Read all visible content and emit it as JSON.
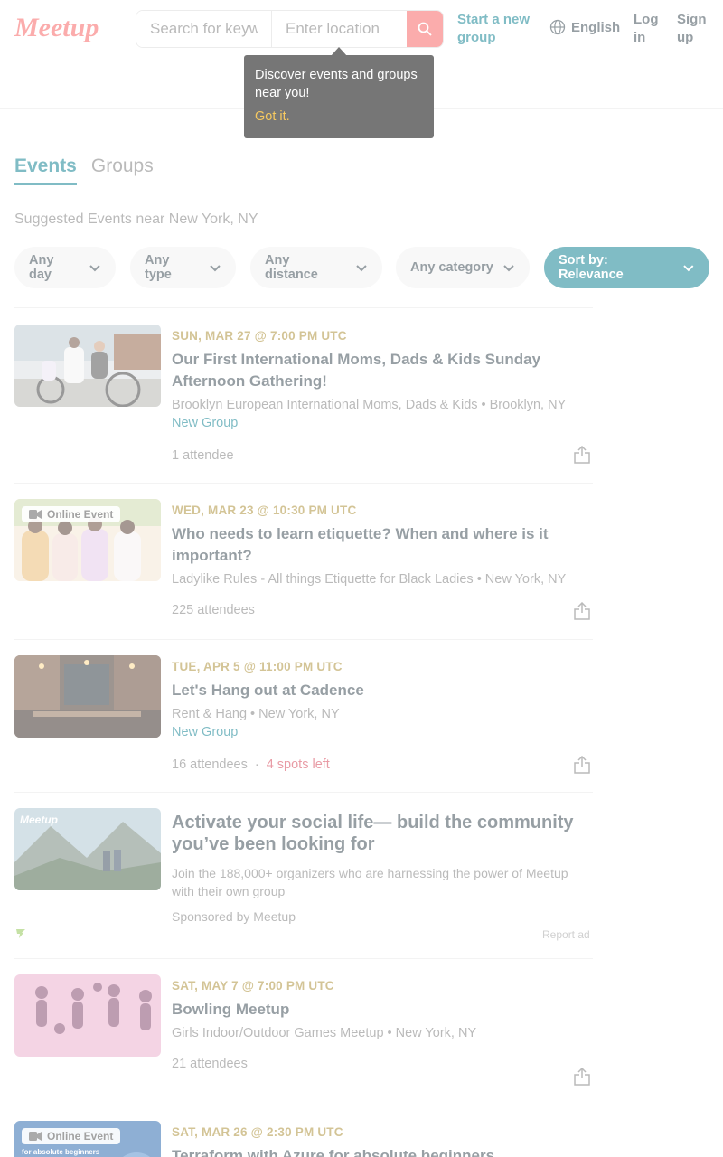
{
  "header": {
    "logo_text": "Meetup",
    "search_placeholder": "Search for keyword",
    "location_placeholder": "Enter location",
    "start_group": "Start a new group",
    "language": "English",
    "login": "Log in",
    "signup": "Sign up"
  },
  "popover": {
    "text": "Discover events and groups near you!",
    "button": "Got it."
  },
  "tabs": [
    {
      "label": "Events",
      "active": true
    },
    {
      "label": "Groups",
      "active": false
    }
  ],
  "subtitle": "Suggested Events near New York, NY",
  "filters": [
    "Any day",
    "Any type",
    "Any distance",
    "Any category"
  ],
  "sort": "Sort by: Relevance",
  "events": [
    {
      "date": "SUN, MAR 27 @ 7:00 PM UTC",
      "title": "Our First International Moms, Dads & Kids Sunday Afternoon Gathering!",
      "group": "Brooklyn European International Moms, Dads & Kids • Brooklyn, NY",
      "new_group": "New Group",
      "attendees": "1 attendee"
    },
    {
      "badge": "Online Event",
      "date": "WED, MAR 23 @ 10:30 PM UTC",
      "title": "Who needs to learn etiquette? When and where is it important?",
      "group": "Ladylike Rules - All things Etiquette for Black Ladies • New York, NY",
      "attendees": "225 attendees"
    },
    {
      "date": "TUE, APR 5 @ 11:00 PM UTC",
      "title": "Let's Hang out at Cadence",
      "group": "Rent & Hang • New York, NY",
      "new_group": "New Group",
      "attendees": "16 attendees",
      "spots": "4 spots left"
    },
    {
      "date": "SAT, MAY 7 @ 7:00 PM UTC",
      "title": "Bowling Meetup",
      "group": "Girls Indoor/Outdoor Games Meetup • New York, NY",
      "attendees": "21 attendees"
    },
    {
      "badge": "Online Event",
      "date": "SAT, MAR 26 @ 2:30 PM UTC",
      "title": "Terraform with Azure for absolute beginners",
      "thumb_text": "for absolute beginners"
    }
  ],
  "separator": "·",
  "ad": {
    "thumb_label": "Meetup",
    "title": "Activate your social life— build the community you’ve been looking for",
    "body": "Join the 188,000+ organizers who are harnessing the power of Meetup with their own group",
    "sponsor": "Sponsored by Meetup",
    "report": "Report ad"
  },
  "colors": {
    "brand_red": "#f65858",
    "teal": "#00798a",
    "date_gold": "#a7892c",
    "spots_red": "#d1374a"
  }
}
